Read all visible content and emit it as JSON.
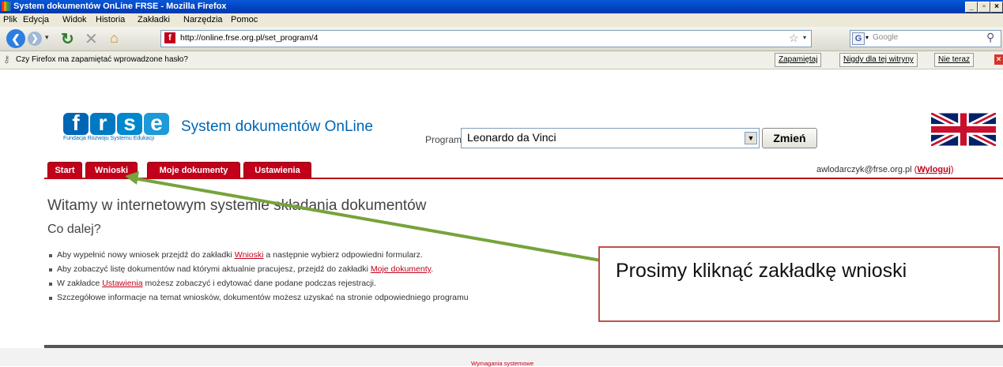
{
  "window": {
    "title": "System dokumentów OnLine FRSE - Mozilla Firefox"
  },
  "menu": [
    "Plik",
    "Edycja",
    "Widok",
    "Historia",
    "Zakładki",
    "Narzędzia",
    "Pomoc"
  ],
  "navbar": {
    "url": "http://online.frse.org.pl/set_program/4",
    "search_placeholder": "Google"
  },
  "notification": {
    "text": "Czy Firefox ma zapamiętać wprowadzone hasło?",
    "remember": "Zapamiętaj",
    "never": "Nigdy dla tej witryny",
    "not_now": "Nie teraz"
  },
  "header": {
    "logo_letters": [
      "f",
      "r",
      "s",
      "e"
    ],
    "logo_caption": "Fundacja Rozwoju Systemu Edukacji",
    "site_title": "System dokumentów OnLine",
    "program_label": "Program",
    "program_value": "Leonardo da Vinci",
    "change_button": "Zmień"
  },
  "tabs": [
    "Start",
    "Wnioski",
    "Moje dokumenty",
    "Ustawienia"
  ],
  "user": {
    "email": "awlodarczyk@frse.org.pl",
    "logout": "Wyloguj",
    "open": "(",
    "close": ")"
  },
  "content": {
    "heading": "Witamy w internetowym systemie składania dokumentów",
    "subheading": "Co dalej?",
    "items": [
      {
        "before": "Aby wypełnić nowy wniosek przejdź do zakładki ",
        "link": "Wnioski",
        "after": " a następnie wybierz odpowiedni formularz."
      },
      {
        "before": "Aby zobaczyć listę dokumentów nad którymi aktualnie pracujesz, przejdź do zakładki ",
        "link": "Moje dokumenty",
        "after": "."
      },
      {
        "before": "W zakładce ",
        "link": "Ustawienia",
        "after": " możesz zobaczyć i edytować dane podane podczas rejestracji."
      },
      {
        "before": "Szczegółowe informacje na temat wniosków, dokumentów możesz uzyskać na stronie odpowiedniego programu",
        "link": "",
        "after": ""
      }
    ]
  },
  "footer": {
    "link": "Wymagania systemowe"
  },
  "callout": {
    "text": "Prosimy kliknąć zakładkę wnioski"
  },
  "colors": {
    "accent": "#c2001b",
    "logo_blue": "#0066b3",
    "arrow": "#77a33b",
    "callout_border": "#c0504d"
  }
}
